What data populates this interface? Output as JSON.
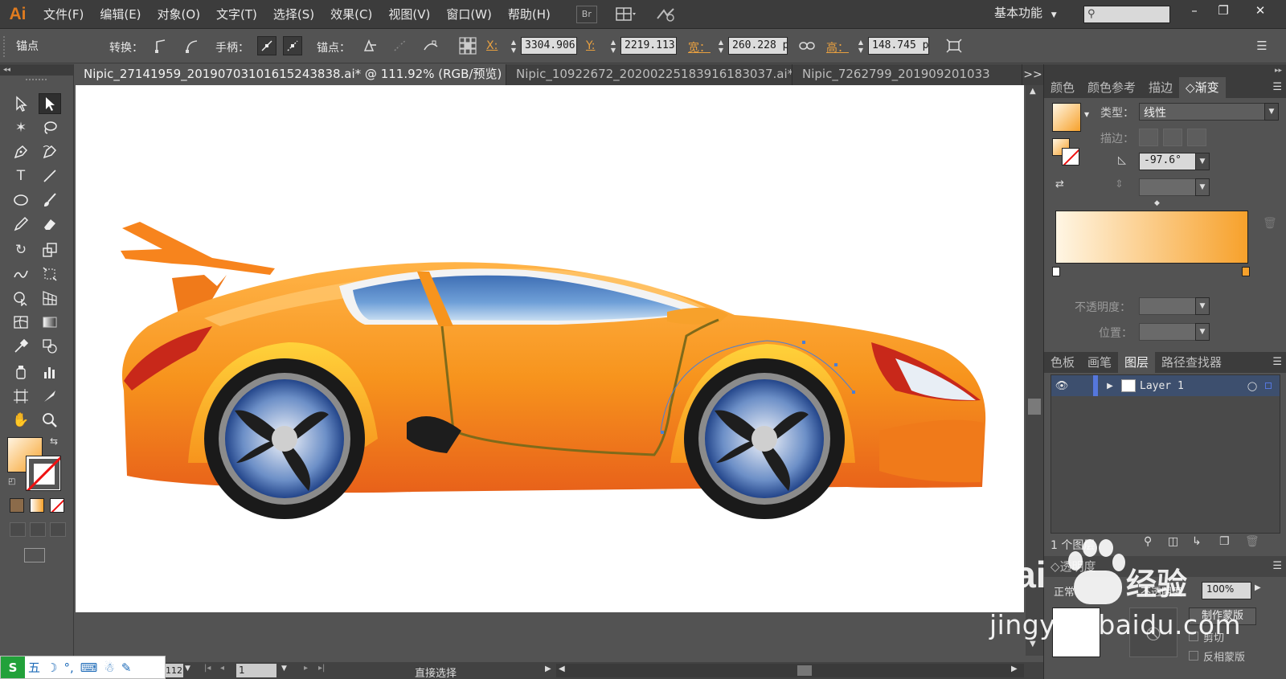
{
  "app": {
    "logo": "Ai",
    "workspace": "基本功能"
  },
  "menu": [
    "文件(F)",
    "编辑(E)",
    "对象(O)",
    "文字(T)",
    "选择(S)",
    "效果(C)",
    "视图(V)",
    "窗口(W)",
    "帮助(H)"
  ],
  "menubar_icons": {
    "bridge": "Br",
    "arrange": "arrange-documents-icon",
    "sync": "gpu-sync-icon"
  },
  "search": {
    "placeholder": ""
  },
  "window_controls": [
    "–",
    "❐",
    "✕"
  ],
  "control": {
    "title": "锚点",
    "convert_label": "转换：",
    "handle_label": "手柄：",
    "anchor_label": "锚点：",
    "x_label": "X:",
    "x_value": "3304.906",
    "y_label": "Y:",
    "y_value": "2219.113",
    "w_label": "宽：",
    "w_value": "260.228 p",
    "h_label": "高：",
    "h_value": "148.745 p"
  },
  "tabs": [
    {
      "label": "Nipic_27141959_20190703101615243838.ai* @ 111.92% (RGB/预览)",
      "active": true,
      "close": "×"
    },
    {
      "label": "Nipic_10922672_20200225183916183037.ai*",
      "active": false,
      "close": "×"
    },
    {
      "label": "Nipic_7262799_201909201033",
      "active": false,
      "close": ""
    }
  ],
  "tab_overflow": ">>",
  "gradient_panel": {
    "tabs": [
      "颜色",
      "颜色参考",
      "描边",
      "渐变"
    ],
    "active_tab": "渐变",
    "type_label": "类型：",
    "type_value": "线性",
    "stroke_label": "描边：",
    "angle_value": "-97.6°",
    "opacity_label": "不透明度：",
    "position_label": "位置：",
    "start_color": "#fff6e4",
    "end_color": "#f7a12b"
  },
  "layers_panel": {
    "tabs": [
      "色板",
      "画笔",
      "图层",
      "路径查找器"
    ],
    "active_tab": "图层",
    "layers": [
      {
        "name": "Layer 1"
      }
    ],
    "count_text": "1 个图层"
  },
  "transparency_panel": {
    "title": "透明度",
    "mode": "正常",
    "opacity_label": "不透明度",
    "opacity_value": "100%",
    "make_mask": "制作蒙版",
    "clip": "剪切",
    "invert_mask": "反相蒙版"
  },
  "status": {
    "zoom": "112",
    "page": "1",
    "tool_name": "直接选择"
  },
  "ime": {
    "logo": "S",
    "items": [
      "五",
      "☽",
      "°,",
      "⌨",
      "☃",
      "✎"
    ]
  },
  "watermark": {
    "brand": "Bai",
    "brand_cn": "经验",
    "url": "jingyan.baidu.com"
  }
}
